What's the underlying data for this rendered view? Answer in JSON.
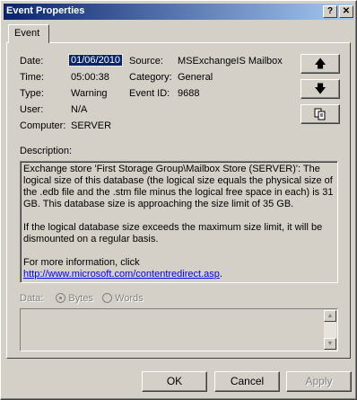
{
  "window": {
    "title": "Event Properties",
    "help_label": "?",
    "close_label": "✕"
  },
  "tab": {
    "label": "Event"
  },
  "fields": {
    "date_label": "Date:",
    "date_value": "01/06/2010",
    "time_label": "Time:",
    "time_value": "05:00:38",
    "type_label": "Type:",
    "type_value": "Warning",
    "user_label": "User:",
    "user_value": "N/A",
    "computer_label": "Computer:",
    "computer_value": "SERVER",
    "source_label": "Source:",
    "source_value": "MSExchangeIS Mailbox",
    "category_label": "Category:",
    "category_value": "General",
    "eventid_label": "Event ID:",
    "eventid_value": "9688"
  },
  "nav": {
    "up_icon": "arrow-up-icon",
    "down_icon": "arrow-down-icon",
    "copy_icon": "copy-icon"
  },
  "description": {
    "label": "Description:",
    "para1": "Exchange store 'First Storage Group\\Mailbox Store (SERVER)': The logical size of this database (the logical size equals the physical size of the .edb file and the .stm file minus the logical free space in each) is 31 GB. This database size is approaching the size limit of 35 GB.",
    "para2": "If the logical database size exceeds the maximum size limit, it will be dismounted on a regular basis.",
    "para3_prefix": "For more information, click ",
    "link": "http://www.microsoft.com/contentredirect.asp",
    "para3_suffix": "."
  },
  "data": {
    "label": "Data:",
    "bytes_label": "Bytes",
    "words_label": "Words",
    "selected": "Bytes"
  },
  "buttons": {
    "ok": "OK",
    "cancel": "Cancel",
    "apply": "Apply"
  }
}
